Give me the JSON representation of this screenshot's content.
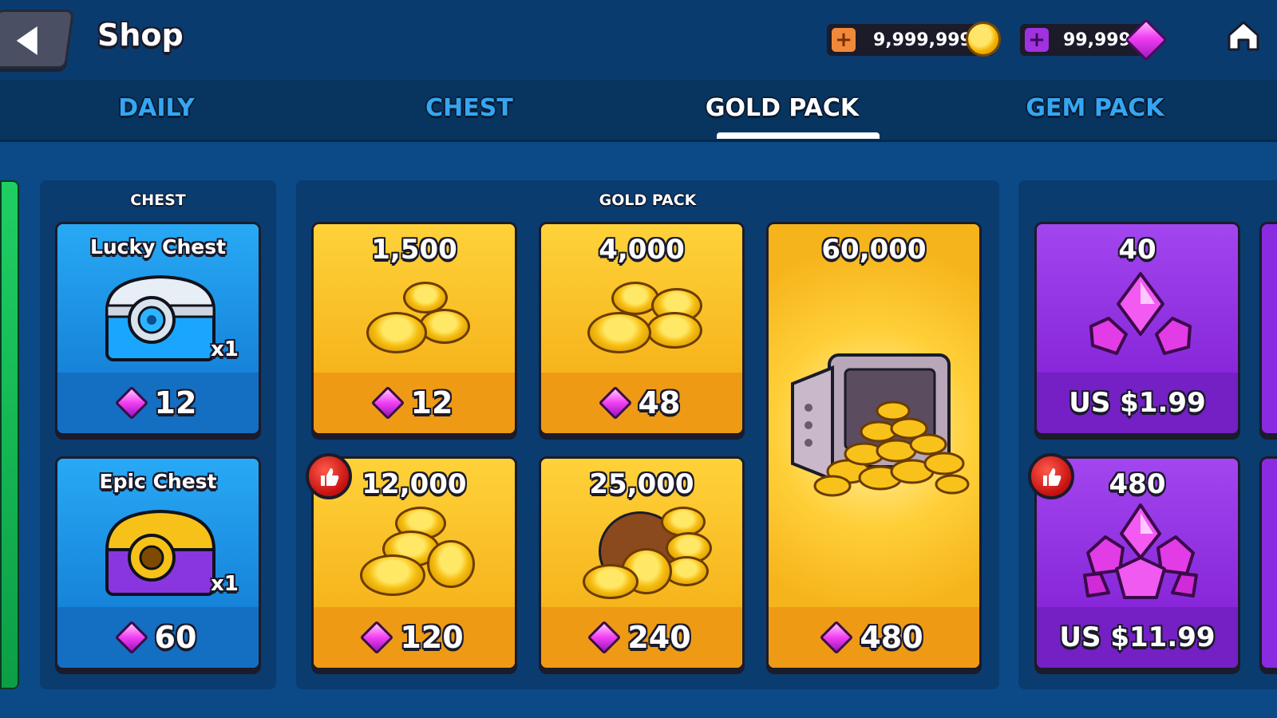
{
  "header": {
    "title": "Shop",
    "currencies": [
      {
        "amount": "9,999,999",
        "type": "gold"
      },
      {
        "amount": "99,999",
        "type": "gems"
      }
    ]
  },
  "tabs": [
    {
      "label": "DAILY"
    },
    {
      "label": "CHEST"
    },
    {
      "label": "GOLD PACK",
      "active": true
    },
    {
      "label": "GEM PACK"
    }
  ],
  "sections": {
    "chest": {
      "title": "CHEST",
      "items": [
        {
          "name": "Lucky Chest",
          "qty": "x1",
          "price": "12"
        },
        {
          "name": "Epic Chest",
          "qty": "x1",
          "price": "60"
        }
      ]
    },
    "gold_pack": {
      "title": "GOLD PACK",
      "items": [
        {
          "amount": "1,500",
          "price": "12"
        },
        {
          "amount": "4,000",
          "price": "48"
        },
        {
          "amount": "60,000",
          "price": "480"
        },
        {
          "amount": "12,000",
          "price": "120",
          "recommended": true
        },
        {
          "amount": "25,000",
          "price": "240"
        }
      ]
    },
    "gem_pack": {
      "items": [
        {
          "amount": "40",
          "price": "US $1.99"
        },
        {
          "amount": "480",
          "price": "US $11.99",
          "recommended": true
        }
      ]
    }
  },
  "colors": {
    "gold_card": "#f4b01e",
    "blue_card": "#1c8be0",
    "purple_card": "#8a2be2",
    "tab_inactive": "#34a6f2",
    "background": "#0b4a86"
  }
}
